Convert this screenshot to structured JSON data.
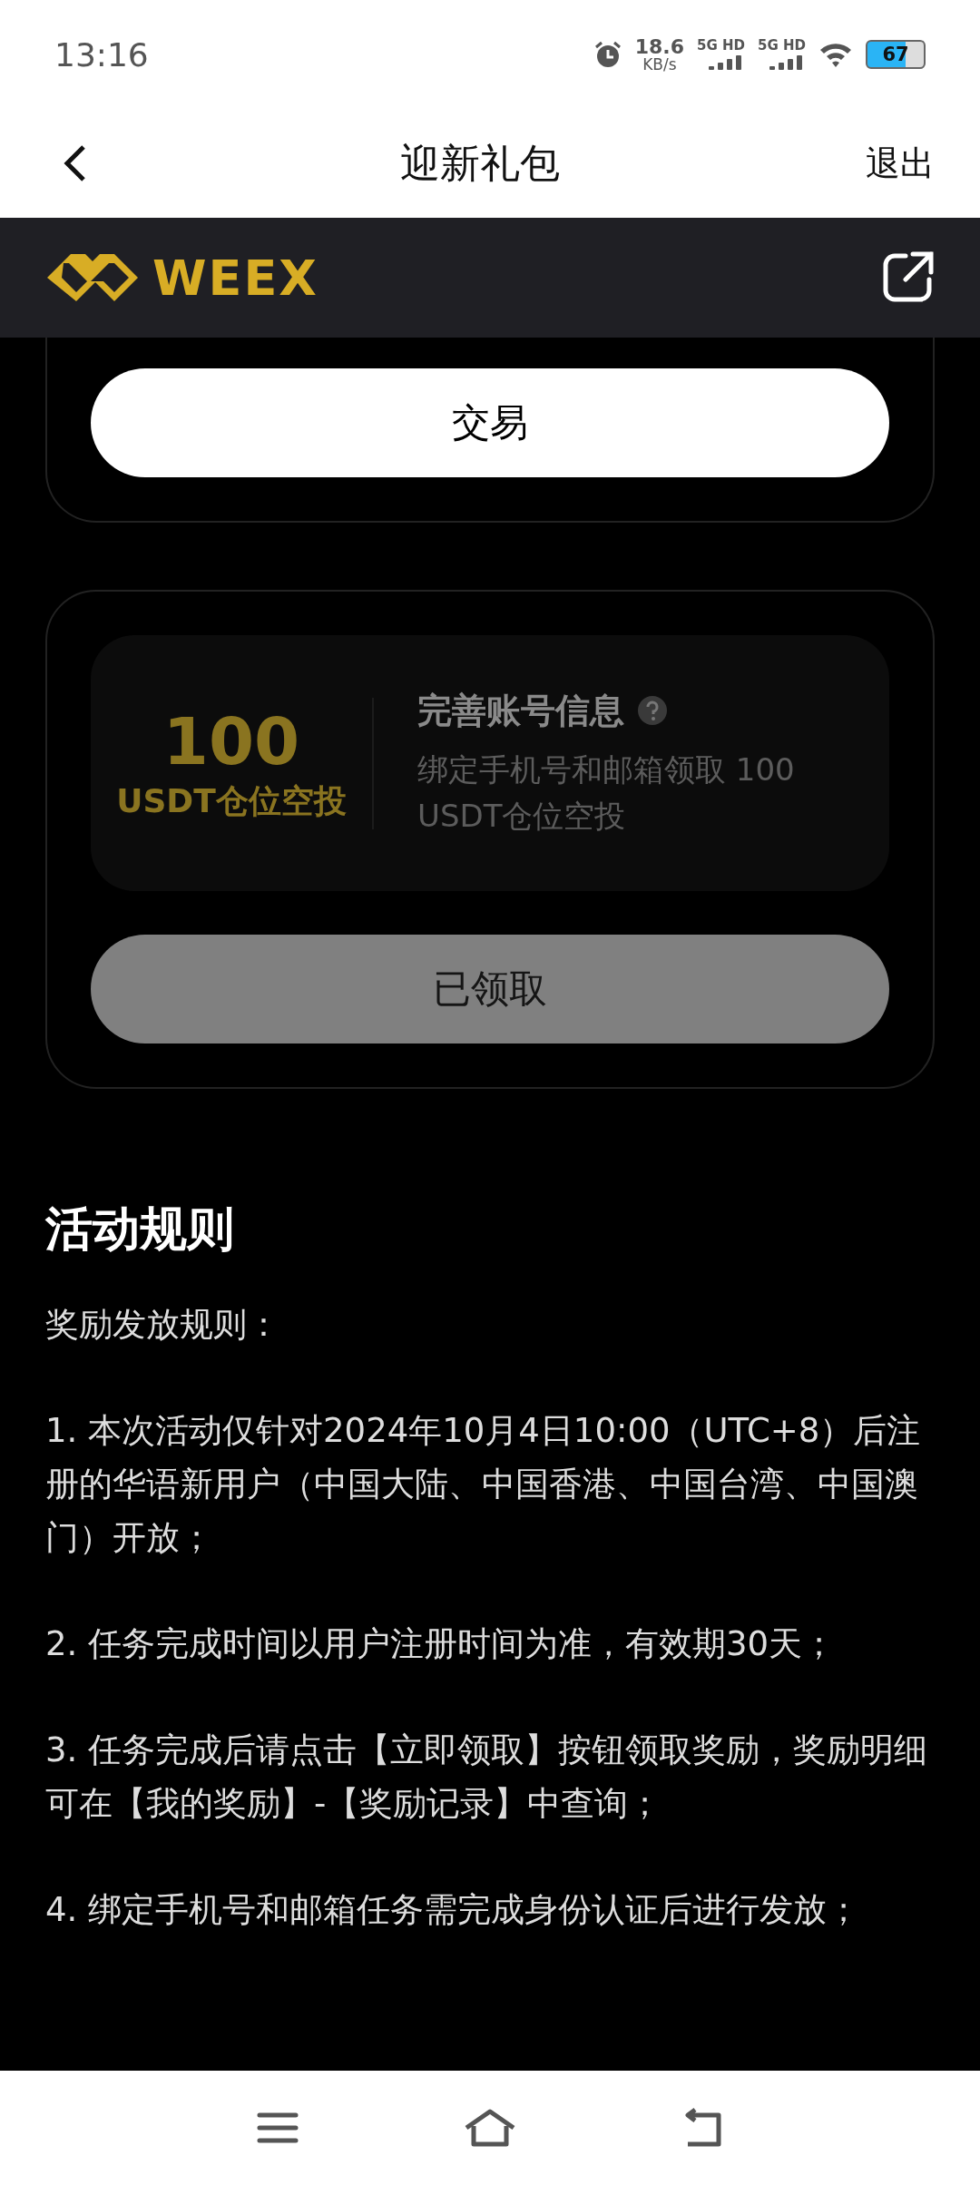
{
  "status_bar": {
    "time": "13:16",
    "speed_value": "18.6",
    "speed_unit": "KB/s",
    "networks": [
      "5G HD",
      "5G HD"
    ],
    "battery": "67"
  },
  "header": {
    "title": "迎新礼包",
    "action": "退出"
  },
  "brand": {
    "name": "WEEX"
  },
  "cards": [
    {
      "kind": "action",
      "button": {
        "label": "交易",
        "disabled": false
      }
    },
    {
      "kind": "task",
      "amount": "100",
      "amount_label": "USDT仓位空投",
      "title": "完善账号信息",
      "description": "绑定手机号和邮箱领取 100 USDT仓位空投",
      "button": {
        "label": "已领取",
        "disabled": true
      }
    }
  ],
  "rules": {
    "title": "活动规则",
    "paragraphs": [
      "奖励发放规则：",
      "1. 本次活动仅针对2024年10月4日10:00（UTC+8）后注册的华语新用户（中国大陆、中国香港、中国台湾、中国澳门）开放；",
      "2. 任务完成时间以用户注册时间为准，有效期30天；",
      "3. 任务完成后请点击【立即领取】按钮领取奖励，奖励明细可在【我的奖励】-【奖励记录】中查询；",
      "4. 绑定手机号和邮箱任务需完成身份认证后进行发放；"
    ]
  }
}
